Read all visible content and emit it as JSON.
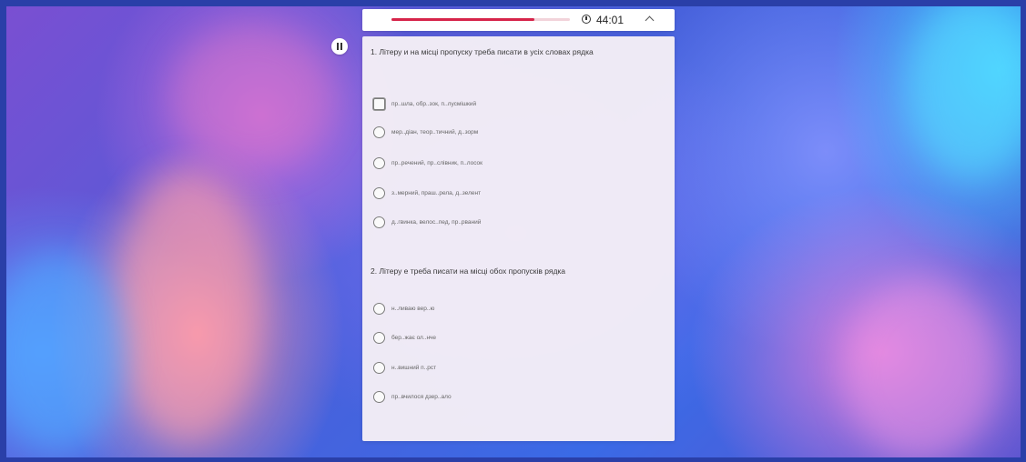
{
  "timer": {
    "text": "44:01",
    "progress": 0.8
  },
  "questions": [
    {
      "text": "1. Літеру и на місці пропуску треба писати в усіх словах рядка",
      "options": [
        "пр..шла, обр..зок, п..лусмішкий",
        "мер..діан, теор..тичний, д..зорм",
        "пр..речений, пр..слівник, п..лосок",
        "з..мерний, праш..рела, д..зелент",
        "д..гвинка, велос..пед, пр..рваний"
      ]
    },
    {
      "text": "2. Літеру е треба писати на місці обох пропусків рядка",
      "options": [
        "н..ливаю вер..ю",
        "бер..жає ол..нче",
        "н..вишний п..рст",
        "пр..вчилося дзер..ало"
      ]
    }
  ]
}
